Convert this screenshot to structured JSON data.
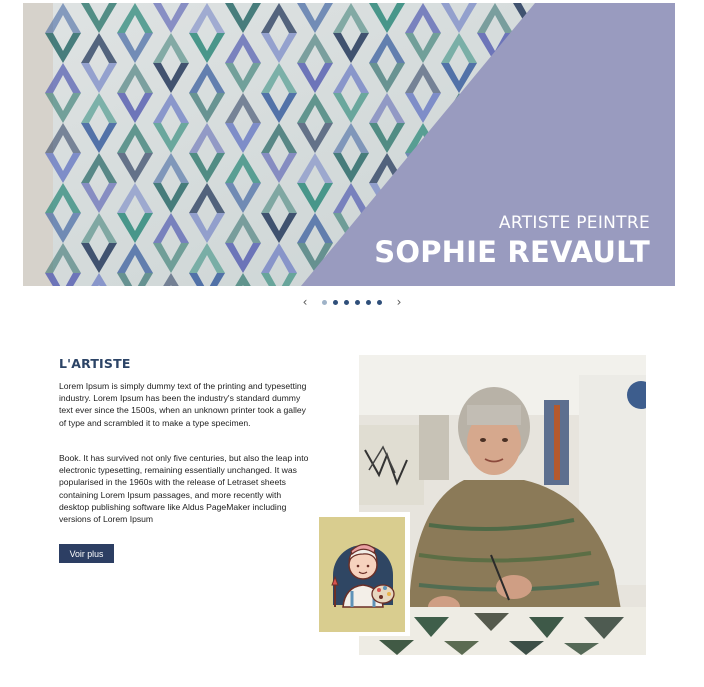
{
  "hero": {
    "subtitle": "ARTISTE PEINTRE",
    "title": "SOPHIE REVAULT",
    "accent_color": "#999bbf",
    "image_description_icon": "watercolor-chevron-painting"
  },
  "slider": {
    "prev_icon": "‹",
    "next_icon": "›",
    "dot_count": 6,
    "active_index": 0
  },
  "artist": {
    "heading": "L'ARTISTE",
    "paragraph_1": "Lorem Ipsum is simply dummy text of the printing and typesetting industry. Lorem Ipsum has been the industry's standard dummy text ever since the 1500s, when an unknown printer took a galley of type and scrambled it to make a type specimen.",
    "paragraph_2": "Book. It has survived not only five centuries, but also the leap into electronic typesetting, remaining essentially unchanged. It was popularised in the 1960s with the release of Letraset sheets containing Lorem Ipsum passages, and more recently with desktop publishing software like Aldus PageMaker including versions of Lorem Ipsum",
    "button_label": "Voir plus",
    "button_color": "#2c3e63",
    "heading_color": "#2c4466",
    "badge_color": "#d9cd8f",
    "badge_icon": "painter-avatar-icon"
  }
}
